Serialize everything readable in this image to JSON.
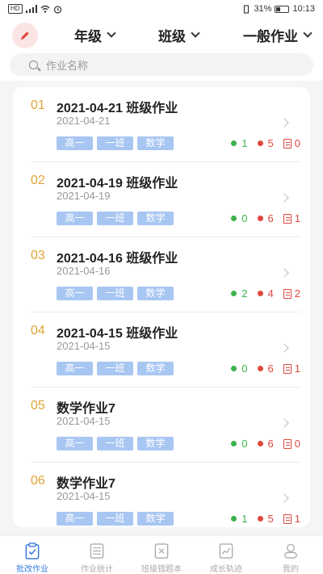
{
  "status_bar": {
    "left": "HD",
    "battery": "31%",
    "time": "10:13"
  },
  "header": {
    "filters": [
      {
        "label": "年级"
      },
      {
        "label": "班级"
      },
      {
        "label": "一般作业"
      }
    ]
  },
  "search": {
    "placeholder": "作业名称"
  },
  "items": [
    {
      "index": "01",
      "title": "2021-04-21 班级作业",
      "date": "2021-04-21",
      "tags": [
        "高一",
        "一班",
        "数学"
      ],
      "green": "1",
      "red": "5",
      "doc": "0"
    },
    {
      "index": "02",
      "title": "2021-04-19 班级作业",
      "date": "2021-04-19",
      "tags": [
        "高一",
        "一班",
        "数学"
      ],
      "green": "0",
      "red": "6",
      "doc": "1"
    },
    {
      "index": "03",
      "title": "2021-04-16 班级作业",
      "date": "2021-04-16",
      "tags": [
        "高一",
        "一班",
        "数学"
      ],
      "green": "2",
      "red": "4",
      "doc": "2"
    },
    {
      "index": "04",
      "title": "2021-04-15 班级作业",
      "date": "2021-04-15",
      "tags": [
        "高一",
        "一班",
        "数学"
      ],
      "green": "0",
      "red": "6",
      "doc": "1"
    },
    {
      "index": "05",
      "title": "数学作业7",
      "date": "2021-04-15",
      "tags": [
        "高一",
        "一班",
        "数学"
      ],
      "green": "0",
      "red": "6",
      "doc": "0"
    },
    {
      "index": "06",
      "title": "数学作业7",
      "date": "2021-04-15",
      "tags": [
        "高一",
        "一班",
        "数学"
      ],
      "green": "1",
      "red": "5",
      "doc": "1"
    }
  ],
  "nav": [
    {
      "label": "批改作业"
    },
    {
      "label": "作业统计"
    },
    {
      "label": "班级错题本"
    },
    {
      "label": "成长轨迹"
    },
    {
      "label": "我的"
    }
  ],
  "colors": {
    "accent": "#3a7be0",
    "index": "#e0a437",
    "tag": "#a8c6f2",
    "green": "#3bb24b",
    "red": "#e0483e"
  }
}
